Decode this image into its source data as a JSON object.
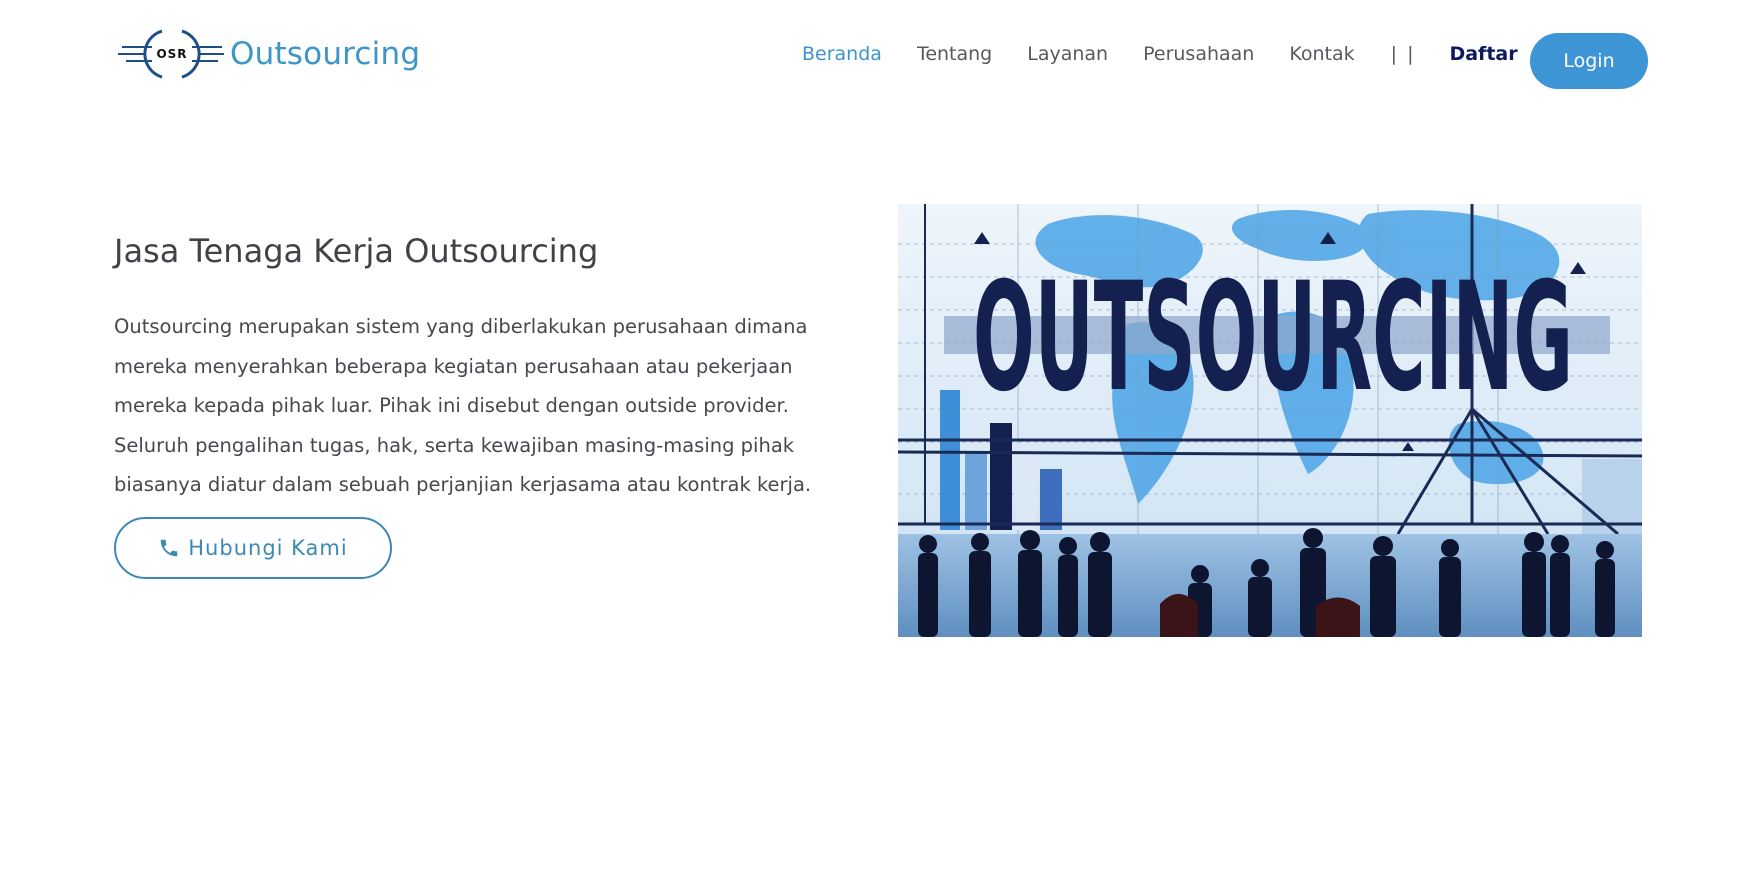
{
  "brand": {
    "logo_text": "OSR",
    "name": "Outsourcing"
  },
  "nav": {
    "items": [
      {
        "label": "Beranda",
        "active": true
      },
      {
        "label": "Tentang"
      },
      {
        "label": "Layanan"
      },
      {
        "label": "Perusahaan"
      },
      {
        "label": "Kontak"
      }
    ],
    "separator": "| |",
    "signup_label": "Daftar",
    "login_label": "Login"
  },
  "hero": {
    "title": "Jasa Tenaga Kerja Outsourcing",
    "description": "Outsourcing merupakan sistem yang diberlakukan perusahaan dimana mereka menyerahkan beberapa kegiatan perusahaan atau pekerjaan mereka kepada pihak luar. Pihak ini disebut dengan outside provider. Seluruh pengalihan tugas, hak, serta kewajiban masing-masing pihak biasanya diatur dalam sebuah perjanjian kerjasama atau kontrak kerja.",
    "cta_label": "Hubungi Kami",
    "cta_icon": "phone-icon",
    "image_word": "OUTSOURCING"
  },
  "colors": {
    "accent": "#3d95c8",
    "login_bg": "#3d95d6",
    "signup": "#0d1a5c",
    "text": "#45494e",
    "image_word": "#14204f"
  }
}
